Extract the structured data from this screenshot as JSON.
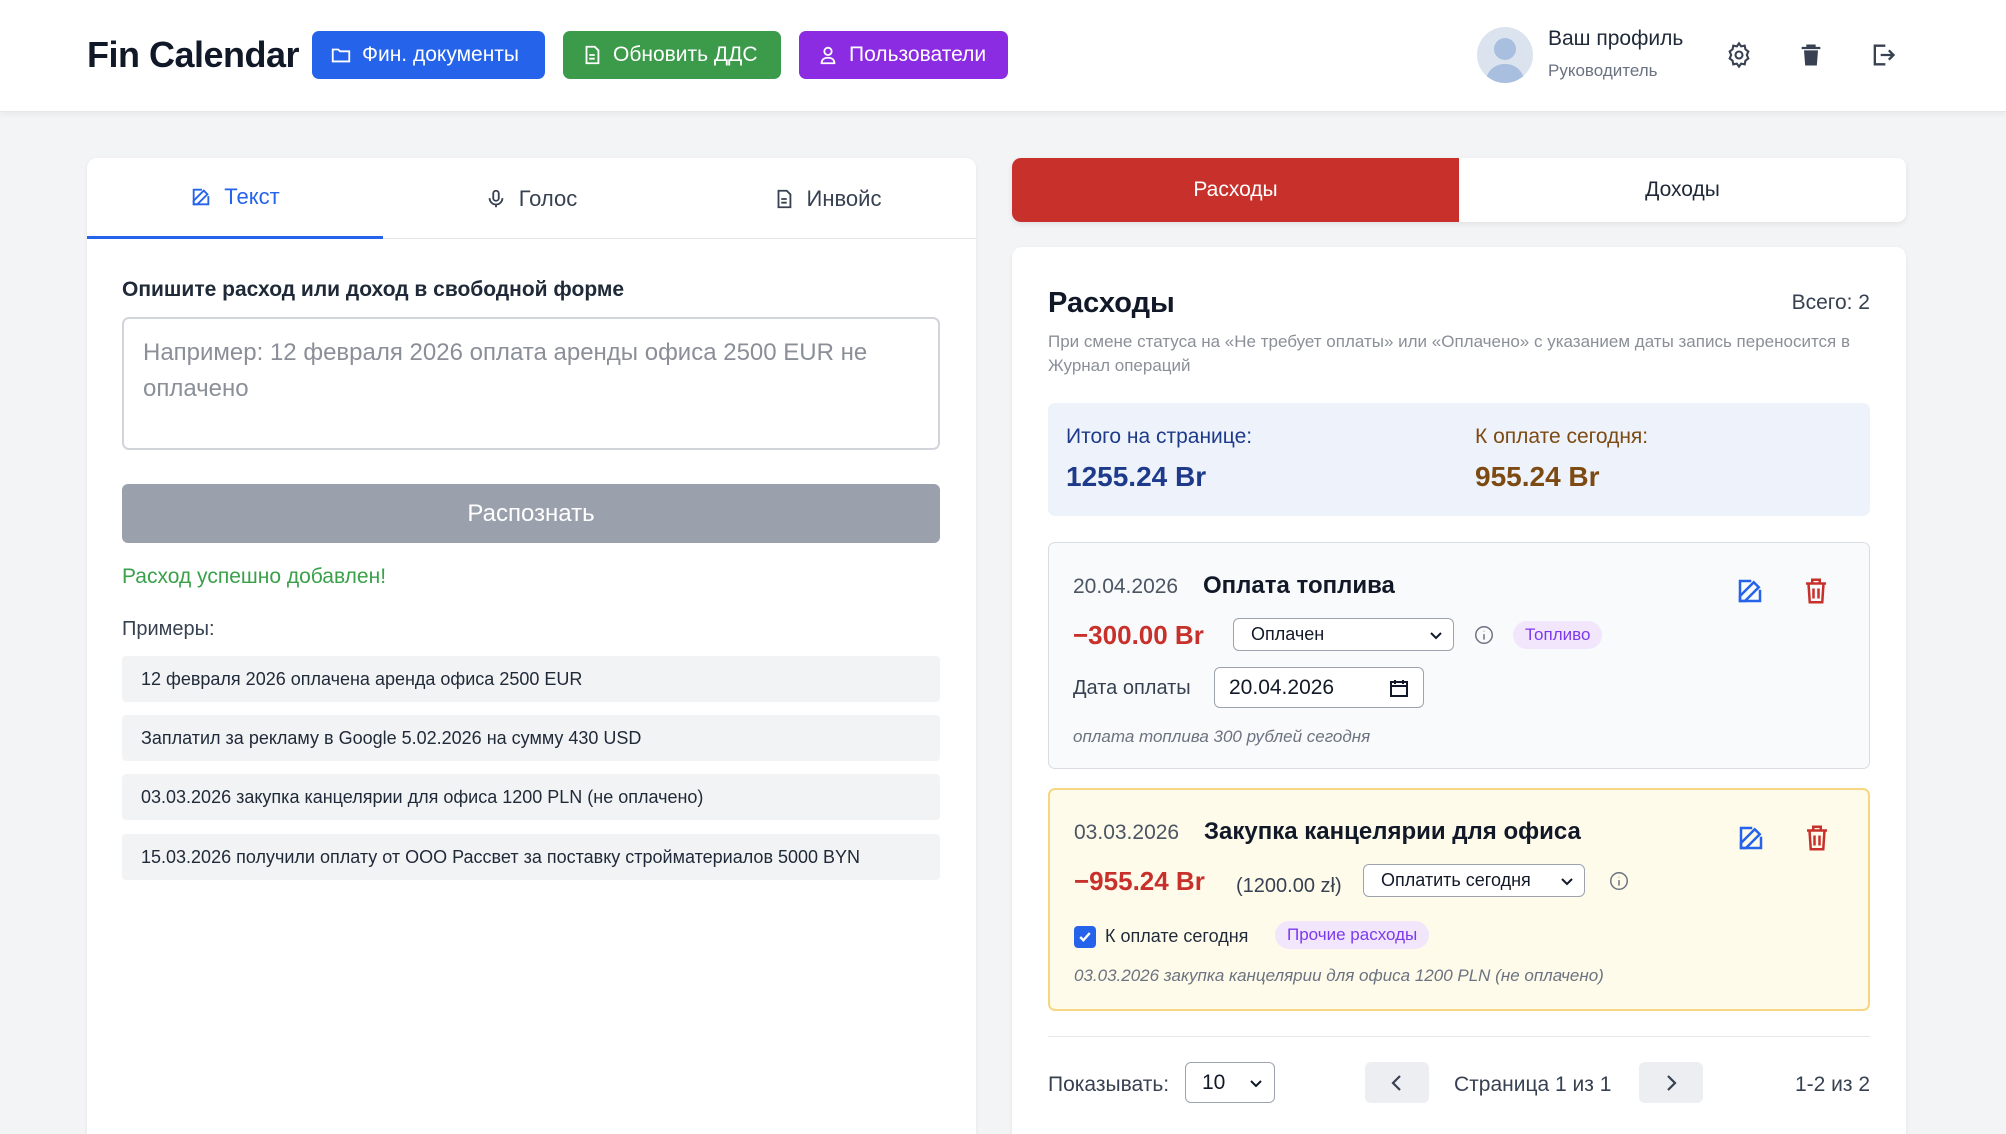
{
  "header": {
    "brand": "Fin Calendar",
    "btn_docs": "Фин. документы",
    "btn_dds": "Обновить ДДС",
    "btn_users": "Пользователи",
    "profile_name": "Ваш профиль",
    "profile_role": "Руководитель"
  },
  "input_panel": {
    "tabs": [
      {
        "label": "Текст",
        "icon": "edit-icon",
        "active": true
      },
      {
        "label": "Голос",
        "icon": "microphone-icon",
        "active": false
      },
      {
        "label": "Инвойс",
        "icon": "document-icon",
        "active": false
      }
    ],
    "field_label": "Опишите расход или доход в свободной форме",
    "placeholder": "Например: 12 февраля 2026 оплата аренды офиса 2500 EUR не оплачено",
    "recognize_label": "Распознать",
    "success_message": "Расход успешно добавлен!",
    "examples_label": "Примеры:",
    "examples": [
      "12 февраля 2026 оплачена аренда офиса 2500 EUR",
      "Заплатил за рекламу в Google 5.02.2026 на сумму 430 USD",
      "03.03.2026 закупка канцелярии для офиса 1200 PLN (не оплачено)",
      "15.03.2026 получили оплату от ООО Рассвет за поставку стройматериалов 5000 BYN"
    ]
  },
  "segment": {
    "expenses": "Расходы",
    "incomes": "Доходы",
    "active": "expenses"
  },
  "list": {
    "title": "Расходы",
    "total": "Всего: 2",
    "note": "При смене статуса на «Не требует оплаты» или «Оплачено» с указанием даты запись переносится в Журнал операций",
    "summary": {
      "page_total_label": "Итого на странице:",
      "page_total_value": "1255.24 Br",
      "due_today_label": "К оплате сегодня:",
      "due_today_value": "955.24 Br"
    },
    "items": [
      {
        "date": "20.04.2026",
        "title": "Оплата топлива",
        "amount": "−300.00 Br",
        "status": "Оплачен",
        "category": "Топливо",
        "payment_date_label": "Дата оплаты",
        "payment_date": "20.04.2026",
        "description": "оплата топлива 300 рублей сегодня"
      },
      {
        "date": "03.03.2026",
        "title": "Закупка канцелярии для офиса",
        "amount": "−955.24 Br",
        "original_amount": "(1200.00 zł)",
        "status": "Оплатить сегодня",
        "due_today_checkbox_label": "К оплате сегодня",
        "due_today_checked": true,
        "category": "Прочие расходы",
        "description": "03.03.2026 закупка канцелярии для офиса 1200 PLN (не оплачено)"
      }
    ],
    "pagination": {
      "show_label": "Показывать:",
      "per_page": "10",
      "page_text": "Страница 1 из 1",
      "range_text": "1-2 из 2"
    }
  },
  "colors": {
    "primary": "#2563eb",
    "green": "#3b9b4a",
    "purple": "#8b2be2",
    "expense_red": "#c8302b",
    "highlight_yellow": "#fefbea"
  }
}
